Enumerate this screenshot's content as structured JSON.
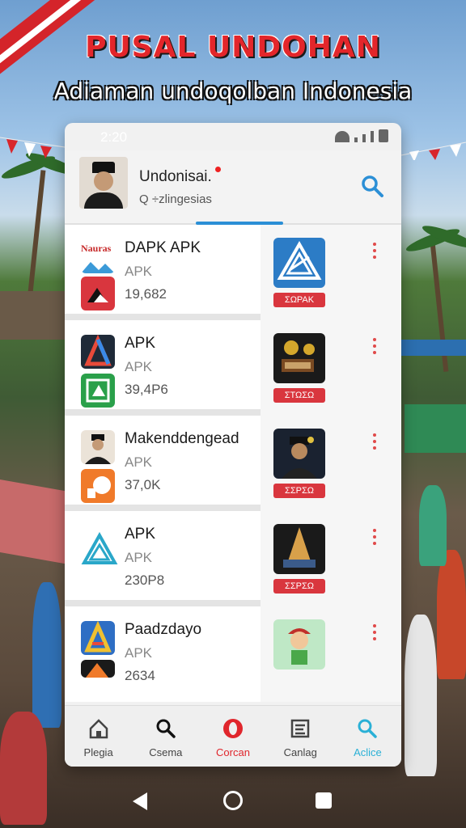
{
  "banner": {
    "title": "PUSAL UNDOHAN",
    "subtitle": "Adiaman undoqolban Indonesia"
  },
  "status_bar": {
    "time": "2:20"
  },
  "header": {
    "profile_name": "Undonisai.",
    "search_hint": "Q ÷zlingesias"
  },
  "apps": [
    {
      "brand": "Nauras",
      "name": "DAPK APK",
      "type": "APK",
      "size": "19,682",
      "button": "ΣΩΡΑΚ"
    },
    {
      "name": "APK",
      "type": "APK",
      "size": "39,4P6",
      "button": "ΣΤΩΣΩ"
    },
    {
      "name": "Makenddengead",
      "type": "APK",
      "size": "37,0K",
      "button": "ΣΣΡΣΩ"
    },
    {
      "name": "APK",
      "type": "APK",
      "size": "230P8",
      "button": "ΣΣΡΣΩ"
    },
    {
      "name": "Paadzdayo",
      "type": "APK",
      "size": "2634",
      "button": ""
    }
  ],
  "bottom_nav": [
    {
      "label": "Plegia",
      "icon": "home-icon"
    },
    {
      "label": "Csema",
      "icon": "search-icon"
    },
    {
      "label": "Corcan",
      "icon": "opera-icon"
    },
    {
      "label": "Canlag",
      "icon": "catalog-icon"
    },
    {
      "label": "Aclice",
      "icon": "search-icon"
    }
  ],
  "colors": {
    "accent_red": "#d9363e",
    "accent_blue": "#2b8fd6",
    "title_red": "#e3262b"
  }
}
